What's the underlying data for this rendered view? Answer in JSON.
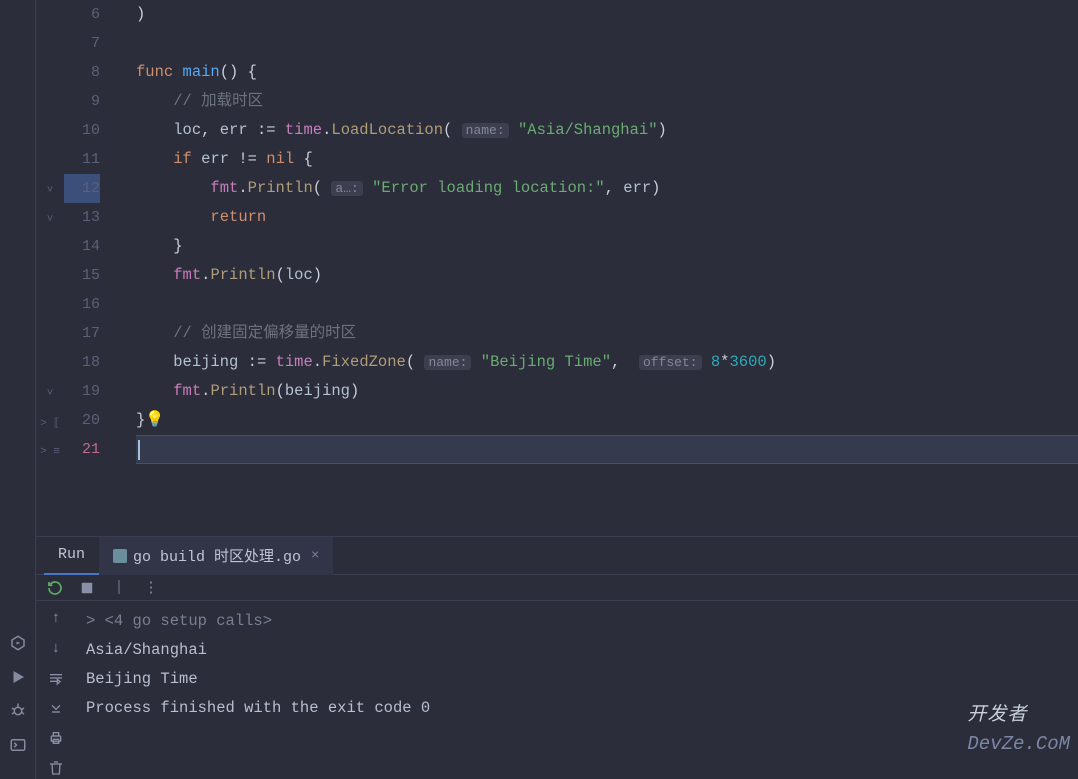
{
  "editor": {
    "lines": [
      {
        "n": 6
      },
      {
        "n": 7
      },
      {
        "n": 8,
        "run": true
      },
      {
        "n": 9
      },
      {
        "n": 10
      },
      {
        "n": 11
      },
      {
        "n": 12,
        "hl": true
      },
      {
        "n": 13
      },
      {
        "n": 14
      },
      {
        "n": 15
      },
      {
        "n": 16
      },
      {
        "n": 17
      },
      {
        "n": 18
      },
      {
        "n": 19
      },
      {
        "n": 20
      },
      {
        "n": 21,
        "active": true
      }
    ],
    "code": {
      "l6": ")",
      "l8_func": "func",
      "l8_main": "main",
      "l9_cmt": "// 加载时区",
      "l10_loc": "loc",
      "l10_err": "err",
      "l10_time": "time",
      "l10_load": "LoadLocation",
      "l10_hint": "name:",
      "l10_str": "\"Asia/Shanghai\"",
      "l11_if": "if",
      "l11_err": "err",
      "l11_nil": "nil",
      "l12_fmt": "fmt",
      "l12_println": "Println",
      "l12_hint": "a…:",
      "l12_str": "\"Error loading location:\"",
      "l12_err": "err",
      "l13_return": "return",
      "l15_fmt": "fmt",
      "l15_println": "Println",
      "l15_loc": "loc",
      "l17_cmt": "// 创建固定偏移量的时区",
      "l18_bj": "beijing",
      "l18_time": "time",
      "l18_fz": "FixedZone",
      "l18_hint1": "name:",
      "l18_str": "\"Beijing Time\"",
      "l18_hint2": "offset:",
      "l18_num1": "8",
      "l18_star": "*",
      "l18_num2": "3600",
      "l19_fmt": "fmt",
      "l19_println": "Println",
      "l19_bj": "beijing"
    }
  },
  "panel": {
    "run_tab": "Run",
    "file_tab": "go build 时区处理.go",
    "console": {
      "setup": "<4 go setup calls>",
      "out1": "Asia/Shanghai",
      "out2": "Beijing Time",
      "exit": "Process finished with the exit code 0"
    }
  },
  "watermark": {
    "cn": "开发者",
    "en": "DevZe.CoM"
  }
}
